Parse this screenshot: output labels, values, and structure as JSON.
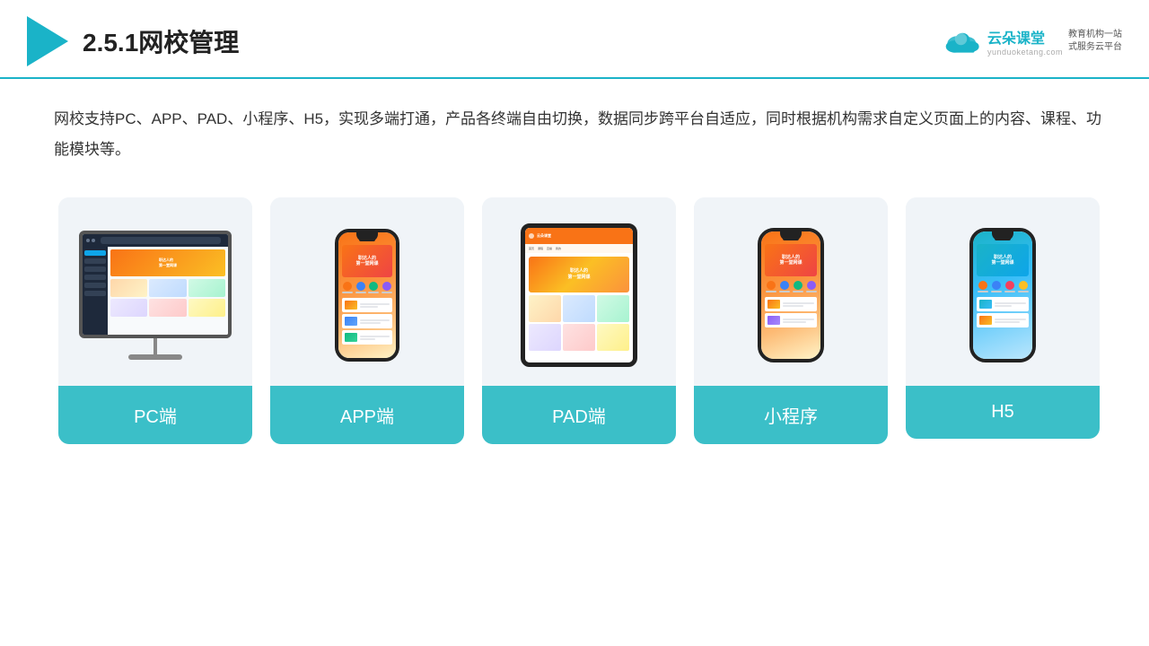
{
  "header": {
    "title": "2.5.1网校管理",
    "brand": {
      "name": "云朵课堂",
      "url": "yunduoketang.com",
      "tagline": "教育机构一站\n式服务云平台"
    }
  },
  "description": "网校支持PC、APP、PAD、小程序、H5，实现多端打通，产品各终端自由切换，数据同步跨平台自适应，同时根据机构需求自定义页面上的内容、课程、功能模块等。",
  "cards": [
    {
      "id": "pc",
      "label": "PC端",
      "device": "pc"
    },
    {
      "id": "app",
      "label": "APP端",
      "device": "phone"
    },
    {
      "id": "pad",
      "label": "PAD端",
      "device": "tablet"
    },
    {
      "id": "miniprogram",
      "label": "小程序",
      "device": "phone"
    },
    {
      "id": "h5",
      "label": "H5",
      "device": "phone"
    }
  ],
  "colors": {
    "accent": "#1ab3c8",
    "card_bg": "#eef2f7",
    "card_label_bg": "#3bbfc8",
    "device_border": "#222222",
    "header_border": "#1ab3c8"
  }
}
